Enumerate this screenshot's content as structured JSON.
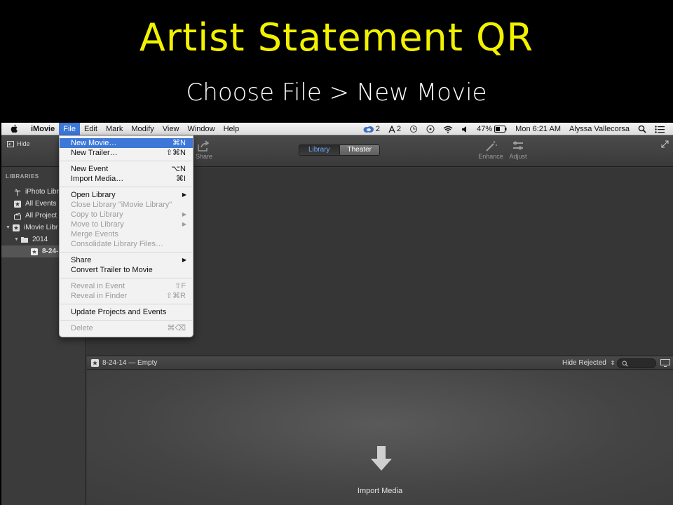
{
  "slide": {
    "title": "Artist Statement QR",
    "subtitle": "Choose File > New Movie"
  },
  "menubar": {
    "app": "iMovie",
    "items": [
      "File",
      "Edit",
      "Mark",
      "Modify",
      "View",
      "Window",
      "Help"
    ],
    "status": {
      "cc_count": "2",
      "ai_count": "2",
      "battery": "47%",
      "clock": "Mon 6:21 AM",
      "user": "Alyssa Vallecorsa"
    }
  },
  "toolbar": {
    "hide": "Hide",
    "share": "Share",
    "library_tab": "Library",
    "theater_tab": "Theater",
    "enhance": "Enhance",
    "adjust": "Adjust"
  },
  "sidebar": {
    "heading": "LIBRARIES",
    "items": [
      "iPhoto Libr",
      "All Events",
      "All Project",
      "iMovie Libr",
      "2014",
      "8-24-"
    ]
  },
  "browser": {
    "event_title": "8-24-14 — Empty",
    "filter": "Hide Rejected",
    "import_label": "Import Media"
  },
  "file_menu": {
    "items": [
      {
        "label": "New Movie…",
        "shortcut": "⌘N"
      },
      {
        "label": "New Trailer…",
        "shortcut": "⇧⌘N"
      },
      {
        "label": "New Event",
        "shortcut": "⌥N"
      },
      {
        "label": "Import Media…",
        "shortcut": "⌘I"
      },
      {
        "label": "Open Library"
      },
      {
        "label": "Close Library \"iMovie Library\""
      },
      {
        "label": "Copy to Library"
      },
      {
        "label": "Move to Library"
      },
      {
        "label": "Merge Events"
      },
      {
        "label": "Consolidate Library Files…"
      },
      {
        "label": "Share"
      },
      {
        "label": "Convert Trailer to Movie"
      },
      {
        "label": "Reveal in Event",
        "shortcut": "⇧F"
      },
      {
        "label": "Reveal in Finder",
        "shortcut": "⇧⌘R"
      },
      {
        "label": "Update Projects and Events"
      },
      {
        "label": "Delete",
        "shortcut": "⌘⌫"
      }
    ]
  },
  "colors": {
    "title_yellow": "#f2f200",
    "menu_highlight": "#3d78d8",
    "selected_tab_text": "#6fa9ff"
  }
}
